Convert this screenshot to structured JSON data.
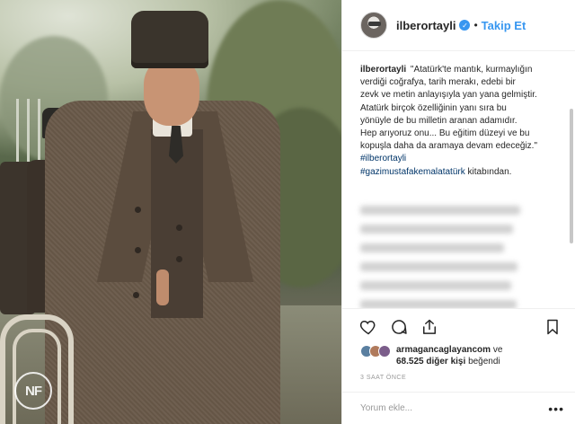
{
  "post": {
    "watermark": "NF",
    "header": {
      "username": "ilberortayli",
      "separator": "•",
      "follow_label": "Takip Et",
      "verified_icon": "check-icon"
    },
    "caption": {
      "username": "ilberortayli",
      "lines": [
        "\"Atatürk'te mantık, kurmaylığın",
        "verdiği coğrafya, tarih merakı, edebi bir",
        "zevk ve metin anlayışıyla yan yana gelmiştir.",
        "Atatürk birçok özelliğinin yanı sıra bu",
        "yönüyle de bu milletin aranan adamıdır.",
        "Hep arıyoruz onu... Bu eğitim düzeyi ve bu",
        "kopuşla daha da aramaya devam edeceğiz.\""
      ],
      "hashtag1": "#ilberortayli",
      "hashtag2": "#gazimustafakemalatatürk",
      "suffix": "kitabından."
    },
    "actions": {
      "like_icon": "heart-icon",
      "comment_icon": "comment-icon",
      "share_icon": "share-icon",
      "save_icon": "bookmark-icon"
    },
    "likes": {
      "user": "armagancaglayancom",
      "conjunction": "ve",
      "count_text": "68.525 diğer kişi",
      "suffix": "beğendi"
    },
    "timestamp": "3 SAAT ÖNCE",
    "comment": {
      "placeholder": "Yorum ekle...",
      "more_label": "•••"
    },
    "colors": {
      "link": "#3897f0",
      "hashtag": "#003569",
      "text": "#262626",
      "muted": "#999999"
    }
  }
}
